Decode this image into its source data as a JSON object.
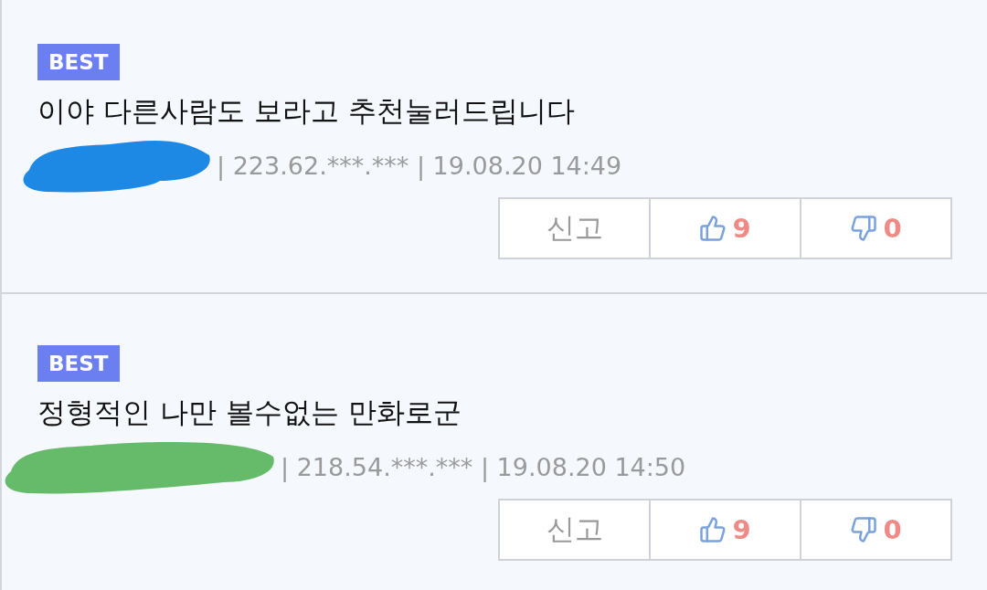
{
  "comments": [
    {
      "badge": "BEST",
      "text": "이야 다른사람도 보라고 추천눌러드립니다",
      "redaction": {
        "color": "#1e88e5"
      },
      "meta": "| 223.62.***.*** | 19.08.20 14:49",
      "report": "신고",
      "likes": "9",
      "dislikes": "0"
    },
    {
      "badge": "BEST",
      "text": "정형적인 나만 볼수없는 만화로군",
      "redaction": {
        "color": "#66bb6a"
      },
      "meta": "| 218.54.***.*** | 19.08.20 14:50",
      "report": "신고",
      "likes": "9",
      "dislikes": "0"
    }
  ]
}
